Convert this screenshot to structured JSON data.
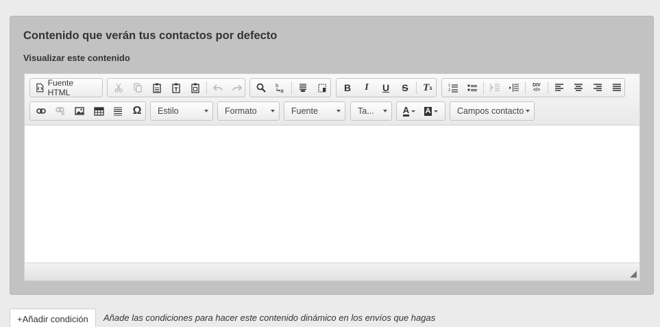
{
  "panel": {
    "title": "Contenido que verán tus contactos por defecto",
    "subtitle": "Visualizar este contenido"
  },
  "toolbar": {
    "source_label": "Fuente HTML",
    "style_label": "Estilo",
    "format_label": "Formato",
    "font_label": "Fuente",
    "size_label": "Ta...",
    "fields_label": "Campos contacto",
    "bold_glyph": "B",
    "italic_glyph": "I",
    "underline_glyph": "U",
    "strike_glyph": "S",
    "removeformat_glyph": "T",
    "omega_glyph": "Ω",
    "textcolor_glyph": "A",
    "bgcolor_glyph": "A",
    "div_glyph": "DIV"
  },
  "footer": {
    "add_condition_label": "+Añadir condición",
    "hint": "Añade las condiciones para hacer este contenido dinámico en los envíos que hagas"
  }
}
